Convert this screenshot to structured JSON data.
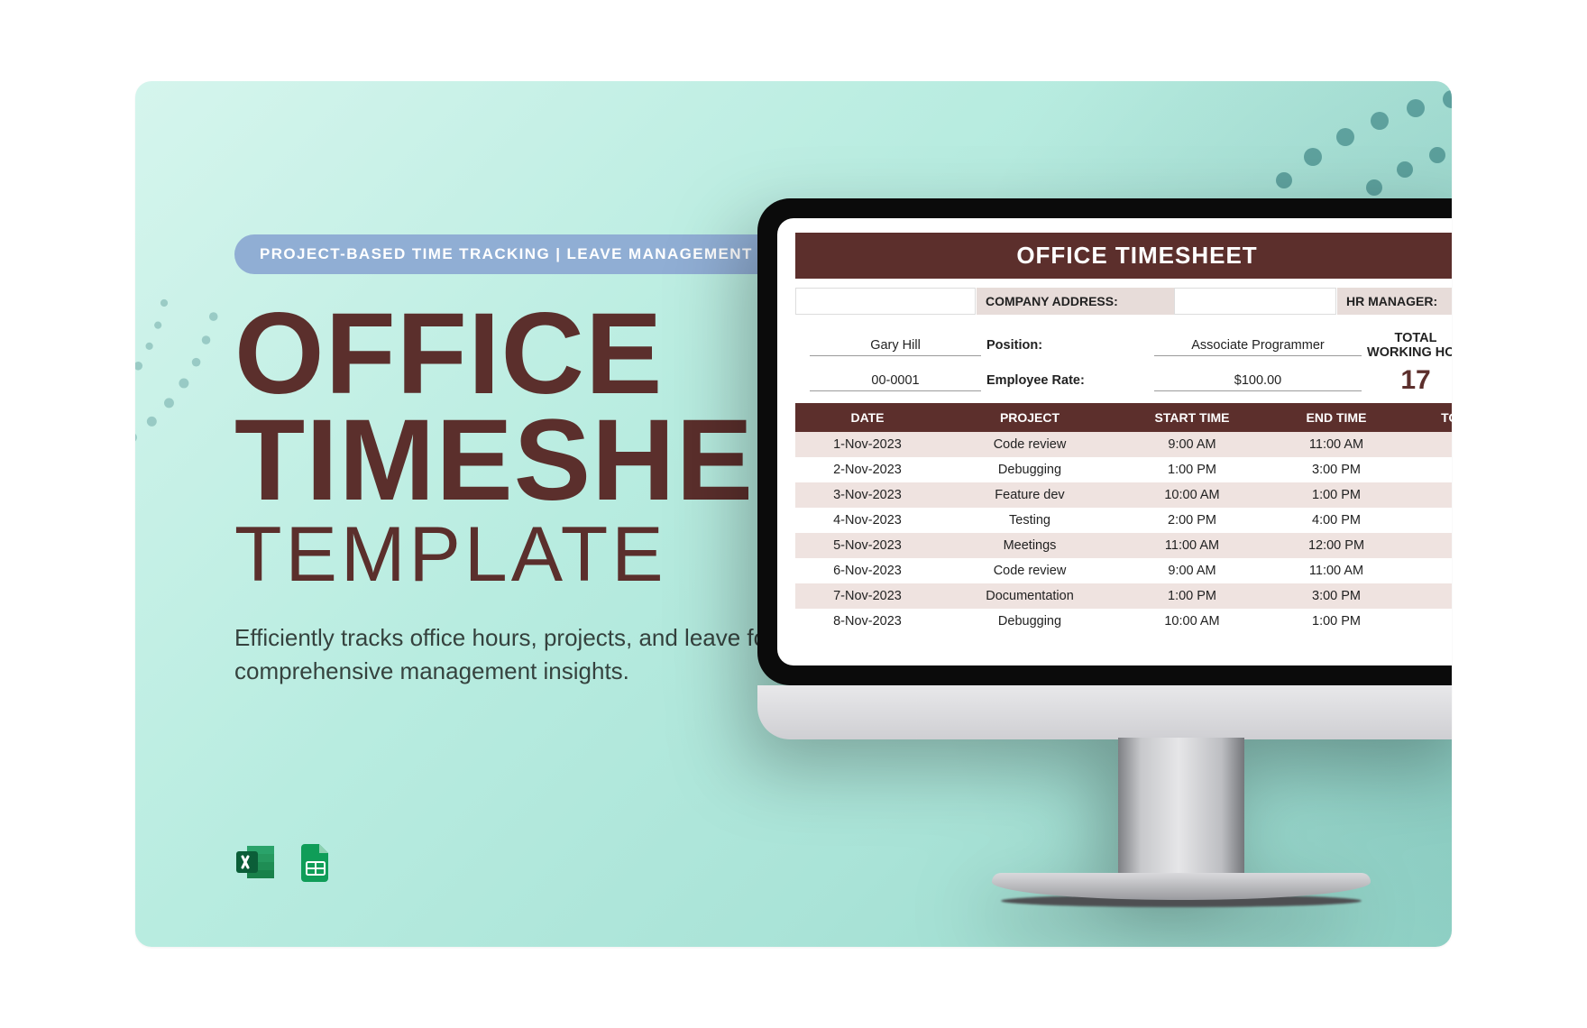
{
  "pill": "PROJECT-BASED TIME TRACKING  |  LEAVE MANAGEMENT",
  "title": {
    "line1": "OFFICE",
    "line2": "TIMESHEET",
    "line3": "TEMPLATE"
  },
  "subtitle": "Efficiently tracks office hours, projects, and leave for comprehensive management insights.",
  "sheet": {
    "heading": "OFFICE TIMESHEET",
    "labels": {
      "company_address": "COMPANY ADDRESS:",
      "hr_manager": "HR MANAGER:"
    },
    "employee": {
      "name": "Gary Hill",
      "id": "00-0001",
      "position_label": "Position:",
      "position": "Associate Programmer",
      "rate_label": "Employee Rate:",
      "rate": "$100.00",
      "total_label": "TOTAL WORKING HOU",
      "total_value": "17"
    },
    "columns": {
      "date": "DATE",
      "project": "PROJECT",
      "start": "START TIME",
      "end": "END TIME",
      "tot": "TOT"
    },
    "rows": [
      {
        "date": "1-Nov-2023",
        "project": "Code review",
        "start": "9:00 AM",
        "end": "11:00 AM"
      },
      {
        "date": "2-Nov-2023",
        "project": "Debugging",
        "start": "1:00 PM",
        "end": "3:00 PM"
      },
      {
        "date": "3-Nov-2023",
        "project": "Feature dev",
        "start": "10:00 AM",
        "end": "1:00 PM"
      },
      {
        "date": "4-Nov-2023",
        "project": "Testing",
        "start": "2:00 PM",
        "end": "4:00 PM"
      },
      {
        "date": "5-Nov-2023",
        "project": "Meetings",
        "start": "11:00 AM",
        "end": "12:00 PM"
      },
      {
        "date": "6-Nov-2023",
        "project": "Code review",
        "start": "9:00 AM",
        "end": "11:00 AM"
      },
      {
        "date": "7-Nov-2023",
        "project": "Documentation",
        "start": "1:00 PM",
        "end": "3:00 PM"
      },
      {
        "date": "8-Nov-2023",
        "project": "Debugging",
        "start": "10:00 AM",
        "end": "1:00 PM"
      }
    ]
  },
  "icons": {
    "excel": "excel-icon",
    "gsheets": "google-sheets-icon"
  }
}
